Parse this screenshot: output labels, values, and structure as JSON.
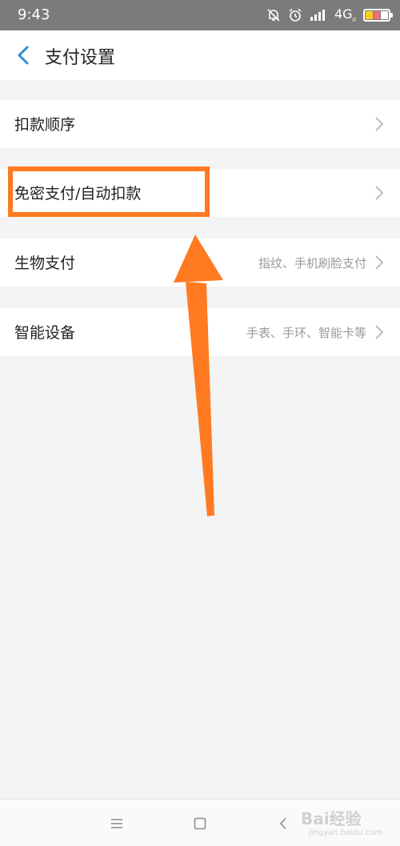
{
  "status_bar": {
    "time": "9:43",
    "network": "4G",
    "network_sub": "ıl",
    "icons": [
      "bell-off-icon",
      "alarm-icon",
      "signal-icon",
      "battery-icon"
    ]
  },
  "header": {
    "title": "支付设置",
    "back_icon": "chevron-left-icon"
  },
  "settings": {
    "items": [
      {
        "label": "扣款顺序",
        "value": ""
      },
      {
        "label": "免密支付/自动扣款",
        "value": ""
      },
      {
        "label": "生物支付",
        "value": "指纹、手机刷脸支付"
      },
      {
        "label": "智能设备",
        "value": "手表、手环、智能卡等"
      }
    ]
  },
  "annotation": {
    "color": "#ff7a21"
  },
  "nav_bar": {
    "icons": [
      "menu-icon",
      "home-square-icon",
      "back-icon"
    ]
  },
  "watermark": {
    "text": "Bai经验",
    "sub": "jingyan.baidu.com"
  },
  "colors": {
    "accent": "#2b8fd6",
    "highlight": "#ff7a21"
  }
}
